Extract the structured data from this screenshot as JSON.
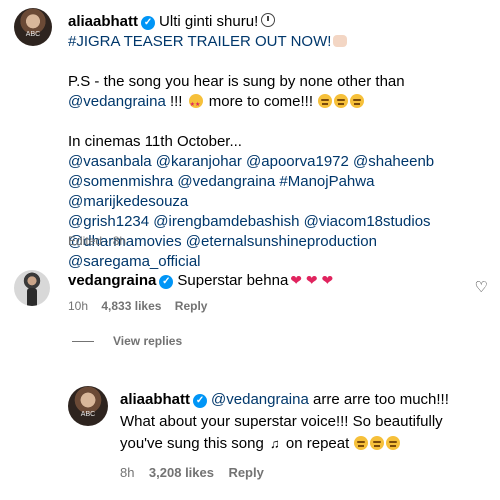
{
  "post": {
    "username": "aliaabhatt",
    "caption_first": "Ulti ginti shuru!",
    "line2": "#JIGRA TEASER TRAILER OUT NOW!",
    "ps_line1": "P.S - the song you hear is sung by none other than",
    "ps_mention": "@vedangraina",
    "ps_mid": " !!! ",
    "ps_after": " more to come!!! ",
    "cinemas": "In cinemas 11th October...",
    "tags_line1": "@vasanbala @karanjohar @apoorva1972 @shaheenb",
    "tags_line2": "@somenmishra @vedangraina #ManojPahwa @marijkedesouza",
    "tags_line3": "@grish1234 @irengbamdebashish @viacom18studios",
    "tags_line4": "@dharmamovies @eternalsunshineproduction",
    "tags_line5": "@saregama_official",
    "meta": "Edited · 8h"
  },
  "comment1": {
    "username": "vedangraina",
    "text": "Superstar behna",
    "time": "10h",
    "likes": "4,833 likes",
    "reply_label": "Reply",
    "hearts": "❤ ❤ ❤"
  },
  "view_replies": "View replies",
  "reply1": {
    "username": "aliaabhatt",
    "mention": "@vedangraina",
    "line1_rest": " arre arre too much!!!",
    "line2": "What about your superstar voice!!! So beautifully",
    "line3_a": "you've sung this song ",
    "line3_b": " on repeat ",
    "time": "8h",
    "likes": "3,208 likes",
    "reply_label": "Reply"
  },
  "colors": {
    "mention": "#00376b",
    "verified": "#0095f6",
    "meta": "#737373"
  },
  "icons": [
    "clock-icon",
    "fist-icon",
    "star-eyes-emoji",
    "grimace-emoji",
    "heart-emoji",
    "music-note-icon",
    "heart-outline-icon",
    "verified-badge"
  ]
}
